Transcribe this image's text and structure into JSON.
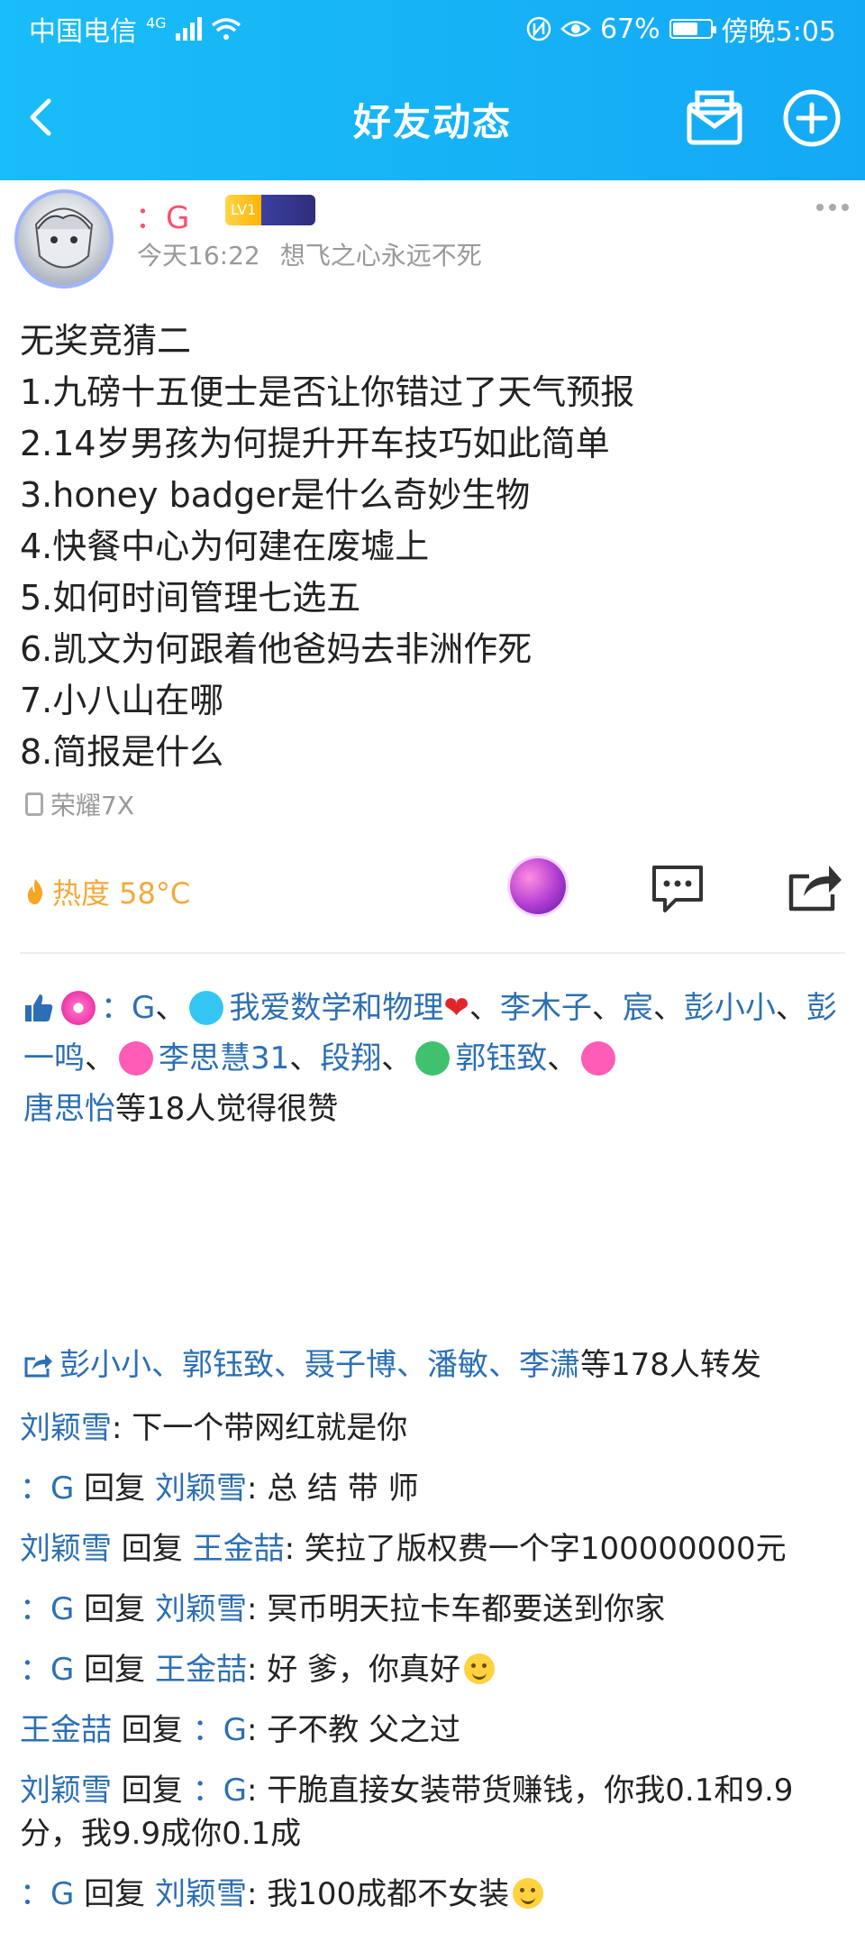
{
  "status_bar": {
    "carrier": "中国电信",
    "network": "4G",
    "battery": "67%",
    "battery_level": 0.67,
    "time": "傍晚5:05"
  },
  "nav": {
    "title": "好友动态"
  },
  "post": {
    "username": "：G",
    "vip_level": "LV1",
    "time": "今天16:22",
    "signature": "想飞之心永远不死",
    "lines": [
      "无奖竞猜二",
      "1.九磅十五便士是否让你错过了天气预报",
      "2.14岁男孩为何提升开车技巧如此简单",
      "3.honey badger是什么奇妙生物",
      "4.快餐中心为何建在废墟上",
      "5.如何时间管理七选五",
      "6.凯文为何跟着他爸妈去非洲作死",
      "7.小八山在哪",
      "8.简报是什么"
    ],
    "device": "荣耀7X",
    "heat": "热度 58°C"
  },
  "likes": {
    "names": [
      "：G",
      "我爱数学和物理",
      "李木子",
      "宸",
      "彭小小",
      "彭一鸣",
      "李思慧31",
      "段翔",
      "郭钰致",
      "唐思怡"
    ],
    "sep": "、",
    "suffix": "等18人觉得很赞"
  },
  "shares": {
    "names": "彭小小、郭钰致、聂子博、潘敏、李潇",
    "suffix": "等178人转发"
  },
  "comments": [
    {
      "from": "刘颖雪",
      "to": "",
      "text": ": 下一个带网红就是你"
    },
    {
      "from": "：G",
      "to": "刘颖雪",
      "text": ": 总 结 带 师"
    },
    {
      "from": "刘颖雪",
      "to": "王金喆",
      "text": ": 笑拉了版权费一个字100000000元"
    },
    {
      "from": "：G",
      "to": "刘颖雪",
      "text": ": 冥币明天拉卡车都要送到你家"
    },
    {
      "from": "：G",
      "to": "王金喆",
      "text": ": 好 爹，你真好"
    },
    {
      "from": "王金喆",
      "to": "：G",
      "text": ": 子不教 父之过"
    },
    {
      "from": "刘颖雪",
      "to": "：G",
      "text": ": 干脆直接女装带货赚钱，你我0.1和9.9分，我9.9成你0.1成"
    },
    {
      "from": "：G",
      "to": "刘颖雪",
      "text": ": 我100成都不女装"
    }
  ],
  "labels": {
    "reply": " 回复 "
  },
  "colors": {
    "header": "#19bdf7",
    "username": "#ff4d6d",
    "link": "#2c6fb4",
    "heat": "#f2a93b"
  }
}
